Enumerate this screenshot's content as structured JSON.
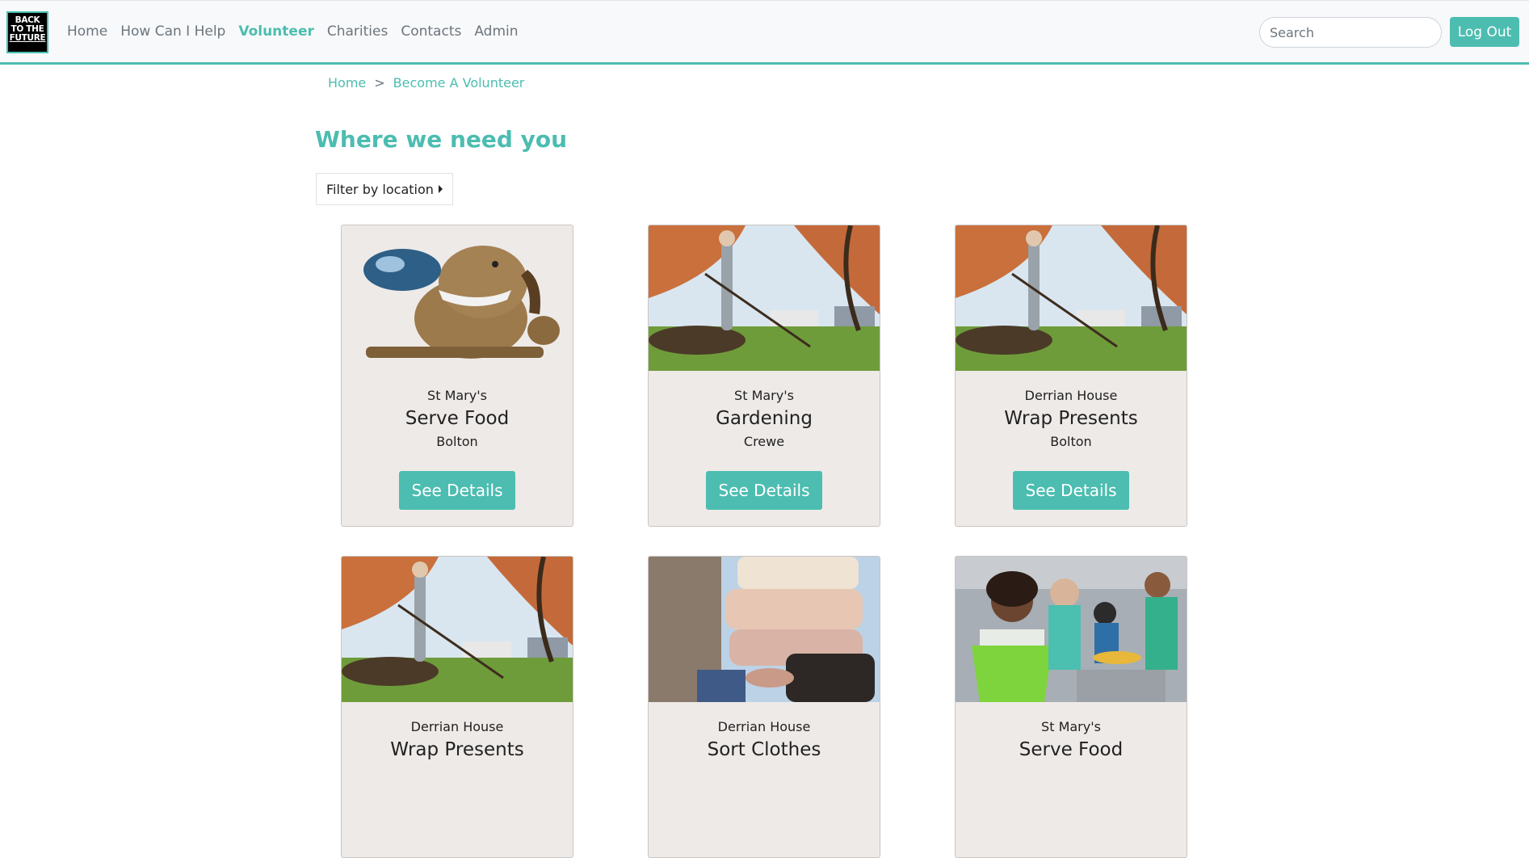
{
  "brand": {
    "logo_lines": [
      "BACK",
      "TO THE",
      "FUTURE"
    ]
  },
  "nav": {
    "items": [
      {
        "label": "Home"
      },
      {
        "label": "How Can I Help"
      },
      {
        "label": "Volunteer"
      },
      {
        "label": "Charities"
      },
      {
        "label": "Contacts"
      },
      {
        "label": "Admin"
      }
    ],
    "active": "Volunteer"
  },
  "search": {
    "placeholder": "Search",
    "value": ""
  },
  "logout": {
    "label": "Log Out"
  },
  "breadcrumb": {
    "home": "Home",
    "separator": ">",
    "current": "Become A Volunteer"
  },
  "page": {
    "title": "Where we need you"
  },
  "filter": {
    "label": "Filter by location"
  },
  "cards": [
    {
      "charity": "St Mary's",
      "task": "Serve Food",
      "location": "Bolton",
      "button": "See Details",
      "image": "cartoon-dog"
    },
    {
      "charity": "St Mary's",
      "task": "Gardening",
      "location": "Crewe",
      "button": "See Details",
      "image": "raking-leaves"
    },
    {
      "charity": "Derrian House",
      "task": "Wrap Presents",
      "location": "Bolton",
      "button": "See Details",
      "image": "raking-leaves"
    },
    {
      "charity": "Derrian House",
      "task": "Wrap Presents",
      "location": "",
      "button": "",
      "image": "raking-leaves"
    },
    {
      "charity": "Derrian House",
      "task": "Sort Clothes",
      "location": "",
      "button": "",
      "image": "folded-sweaters"
    },
    {
      "charity": "St Mary's",
      "task": "Serve Food",
      "location": "",
      "button": "",
      "image": "volunteers-serving"
    }
  ],
  "colors": {
    "accent": "#4cbdb0",
    "card_bg": "#eeeae8",
    "nav_bg": "#f8f9fa"
  }
}
